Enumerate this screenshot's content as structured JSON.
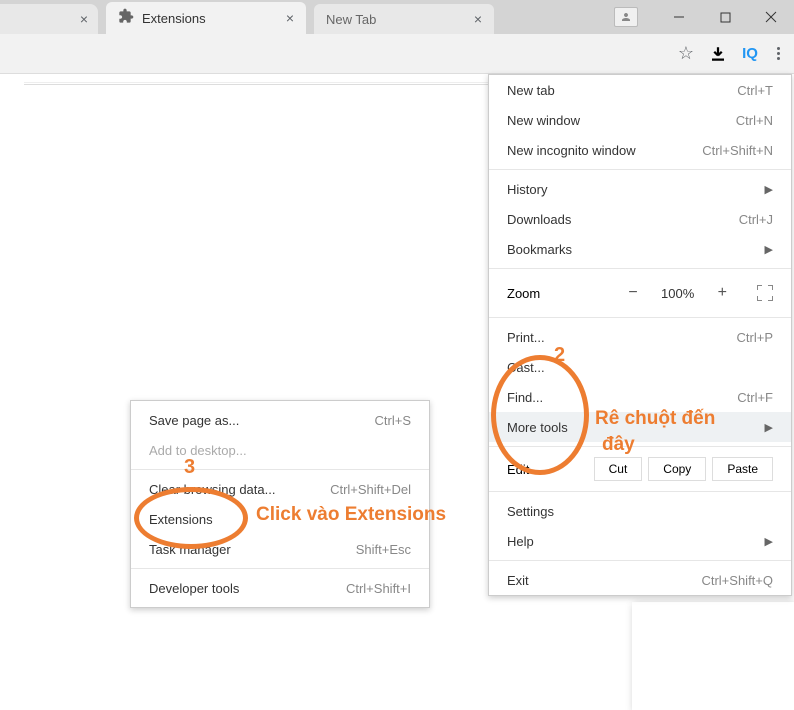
{
  "tabs": {
    "prev": {
      "close": "×"
    },
    "active": {
      "title": "Extensions",
      "close": "×"
    },
    "inactive": {
      "title": "New Tab",
      "close": "×"
    }
  },
  "toolbar": {
    "iq_label": "IQ"
  },
  "main_menu": {
    "new_tab": {
      "label": "New tab",
      "shortcut": "Ctrl+T"
    },
    "new_window": {
      "label": "New window",
      "shortcut": "Ctrl+N"
    },
    "new_incognito": {
      "label": "New incognito window",
      "shortcut": "Ctrl+Shift+N"
    },
    "history": {
      "label": "History",
      "arrow": "▶"
    },
    "downloads": {
      "label": "Downloads",
      "shortcut": "Ctrl+J"
    },
    "bookmarks": {
      "label": "Bookmarks",
      "arrow": "▶"
    },
    "zoom": {
      "label": "Zoom",
      "minus": "−",
      "value": "100%",
      "plus": "+"
    },
    "print": {
      "label": "Print...",
      "shortcut": "Ctrl+P"
    },
    "cast": {
      "label": "Cast..."
    },
    "find": {
      "label": "Find...",
      "shortcut": "Ctrl+F"
    },
    "more_tools": {
      "label": "More tools",
      "arrow": "▶"
    },
    "edit": {
      "label": "Edit",
      "cut": "Cut",
      "copy": "Copy",
      "paste": "Paste"
    },
    "settings": {
      "label": "Settings"
    },
    "help": {
      "label": "Help",
      "arrow": "▶"
    },
    "exit": {
      "label": "Exit",
      "shortcut": "Ctrl+Shift+Q"
    }
  },
  "submenu": {
    "save_page": {
      "label": "Save page as...",
      "shortcut": "Ctrl+S"
    },
    "add_desktop": {
      "label": "Add to desktop..."
    },
    "clear_data": {
      "label": "Clear browsing data...",
      "shortcut": "Ctrl+Shift+Del"
    },
    "extensions": {
      "label": "Extensions"
    },
    "task_manager": {
      "label": "Task manager",
      "shortcut": "Shift+Esc"
    },
    "dev_tools": {
      "label": "Developer tools",
      "shortcut": "Ctrl+Shift+I"
    }
  },
  "annotations": {
    "num2": "2",
    "num3": "3",
    "text2a": "Rê chuột đến",
    "text2b": "đây",
    "text3": "Click vào Extensions"
  }
}
